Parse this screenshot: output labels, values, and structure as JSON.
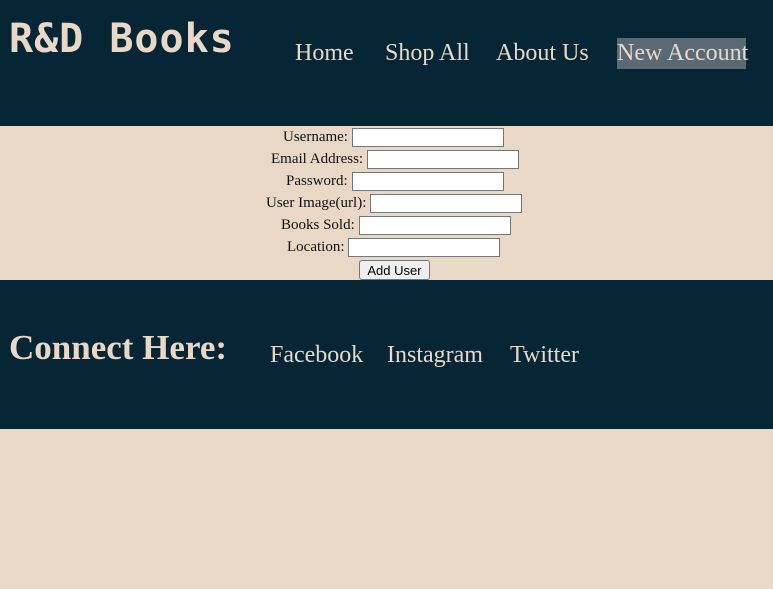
{
  "header": {
    "logo": "R&D Books",
    "nav": [
      {
        "label": "Home"
      },
      {
        "label": "Shop All"
      },
      {
        "label": "About Us"
      },
      {
        "label": "New Account",
        "active": true
      }
    ]
  },
  "form": {
    "fields": [
      {
        "label": "Username:",
        "value": ""
      },
      {
        "label": "Email Address:",
        "value": ""
      },
      {
        "label": "Password:",
        "value": ""
      },
      {
        "label": "User Image(url):",
        "value": ""
      },
      {
        "label": "Books Sold:",
        "value": ""
      },
      {
        "label": "Location:",
        "value": ""
      }
    ],
    "submit_label": "Add User"
  },
  "footer": {
    "heading": "Connect Here:",
    "links": [
      {
        "label": "Facebook"
      },
      {
        "label": "Instagram"
      },
      {
        "label": "Twitter"
      }
    ]
  },
  "colors": {
    "dark": "#062535",
    "light": "#e9d8c6",
    "active_highlight": "#596a74"
  }
}
